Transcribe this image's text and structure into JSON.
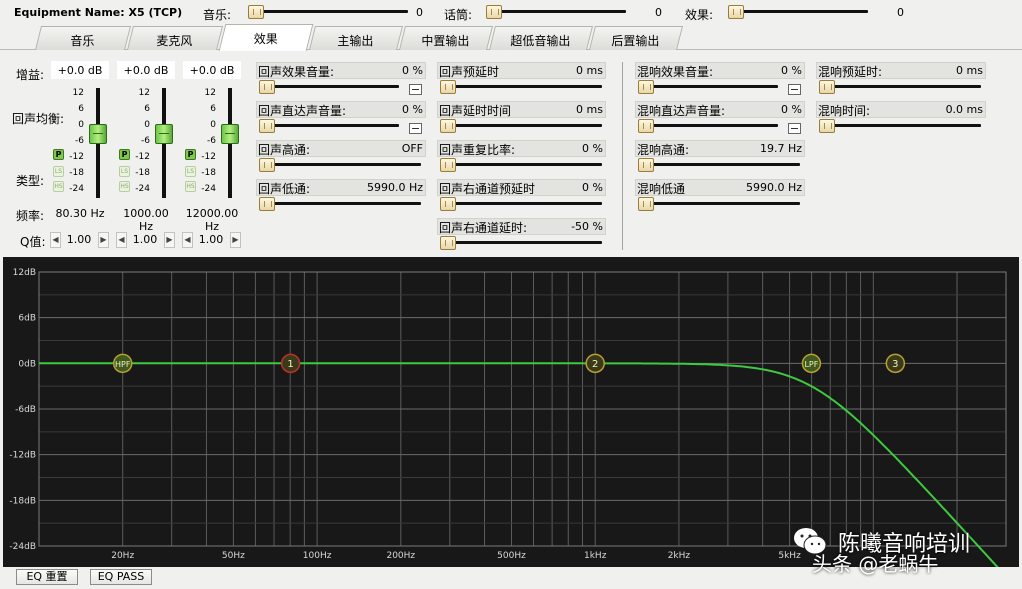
{
  "header": {
    "equipment_label": "Equipment Name: X5 (TCP)",
    "music_label": "音乐:",
    "music_value": "0",
    "music_level": 0,
    "mic_label": "话筒:",
    "mic_value": "0",
    "mic_level": 0,
    "effect_label": "效果:",
    "effect_value": "0",
    "effect_level": 0
  },
  "tabs": [
    {
      "label": "音乐",
      "active": false
    },
    {
      "label": "麦克风",
      "active": false
    },
    {
      "label": "效果",
      "active": true
    },
    {
      "label": "主输出",
      "active": false
    },
    {
      "label": "中置输出",
      "active": false
    },
    {
      "label": "超低音输出",
      "active": false
    },
    {
      "label": "后置输出",
      "active": false
    }
  ],
  "eq": {
    "gain_label": "增益:",
    "balance_label": "回声均衡:",
    "type_label": "类型:",
    "freq_label": "频率:",
    "q_label": "Q值:",
    "scale": [
      "12",
      "6",
      "0",
      "-6",
      "-12",
      "-18",
      "-24"
    ],
    "type_buttons": [
      "P",
      "LS",
      "HS"
    ],
    "bands": [
      {
        "gain": "+0.0 dB",
        "gain_db": 0,
        "freq": "80.30 Hz",
        "q": "1.00",
        "type": "P"
      },
      {
        "gain": "+0.0 dB",
        "gain_db": 0,
        "freq": "1000.00 Hz",
        "q": "1.00",
        "type": "P"
      },
      {
        "gain": "+0.0 dB",
        "gain_db": 0,
        "freq": "12000.00 Hz",
        "q": "1.00",
        "type": "P"
      }
    ]
  },
  "echo": {
    "params": [
      {
        "name": "回声效果音量:",
        "value": "0 %",
        "level": 0,
        "mute": true
      },
      {
        "name": "回声直达声音量:",
        "value": "0 %",
        "level": 0,
        "mute": true
      },
      {
        "name": "回声高通:",
        "value": "OFF",
        "level": 0,
        "mute": false
      },
      {
        "name": "回声低通:",
        "value": "5990.0 Hz",
        "level": 0,
        "mute": false
      }
    ],
    "params2": [
      {
        "name": "回声预延时",
        "value": "0 ms",
        "level": 0
      },
      {
        "name": "回声延时时间",
        "value": "0 ms",
        "level": 0
      },
      {
        "name": "回声重复比率:",
        "value": "0 %",
        "level": 0
      },
      {
        "name": "回声右通道预延时",
        "value": "0 %",
        "level": 0
      },
      {
        "name": "回声右通道延时:",
        "value": "-50 %",
        "level": 0
      }
    ]
  },
  "reverb": {
    "params": [
      {
        "name": "混响效果音量:",
        "value": "0 %",
        "level": 0,
        "mute": true
      },
      {
        "name": "混响直达声音量:",
        "value": "0 %",
        "level": 0,
        "mute": true
      },
      {
        "name": "混响高通:",
        "value": "19.7 Hz",
        "level": 0,
        "mute": false
      },
      {
        "name": "混响低通",
        "value": "5990.0 Hz",
        "level": 0,
        "mute": false
      }
    ],
    "params2": [
      {
        "name": "混响预延时:",
        "value": "0 ms",
        "level": 0
      },
      {
        "name": "混响时间:",
        "value": "0.0 ms",
        "level": 0
      }
    ]
  },
  "graph": {
    "y_labels": [
      "12dB",
      "6dB",
      "0dB",
      "-6dB",
      "-12dB",
      "-18dB",
      "-24dB"
    ],
    "x_labels": [
      {
        "label": "20Hz",
        "hz": 20
      },
      {
        "label": "50Hz",
        "hz": 50
      },
      {
        "label": "100Hz",
        "hz": 100
      },
      {
        "label": "200Hz",
        "hz": 200
      },
      {
        "label": "500Hz",
        "hz": 500
      },
      {
        "label": "1kHz",
        "hz": 1000
      },
      {
        "label": "2kHz",
        "hz": 2000
      },
      {
        "label": "5kHz",
        "hz": 5000
      }
    ],
    "nodes": [
      {
        "label": "HPF",
        "hz": 20
      },
      {
        "label": "1",
        "hz": 80.3
      },
      {
        "label": "2",
        "hz": 1000
      },
      {
        "label": "LPF",
        "hz": 5990
      },
      {
        "label": "3",
        "hz": 12000
      }
    ],
    "curve_color": "#3ec93e",
    "lpf_hz": 5990
  },
  "buttons": {
    "eq_reset": "EQ 重置",
    "eq_pass": "EQ PASS"
  },
  "watermark": {
    "line1": "陈曦音响培训",
    "line2": "头条 @老蜗牛"
  }
}
